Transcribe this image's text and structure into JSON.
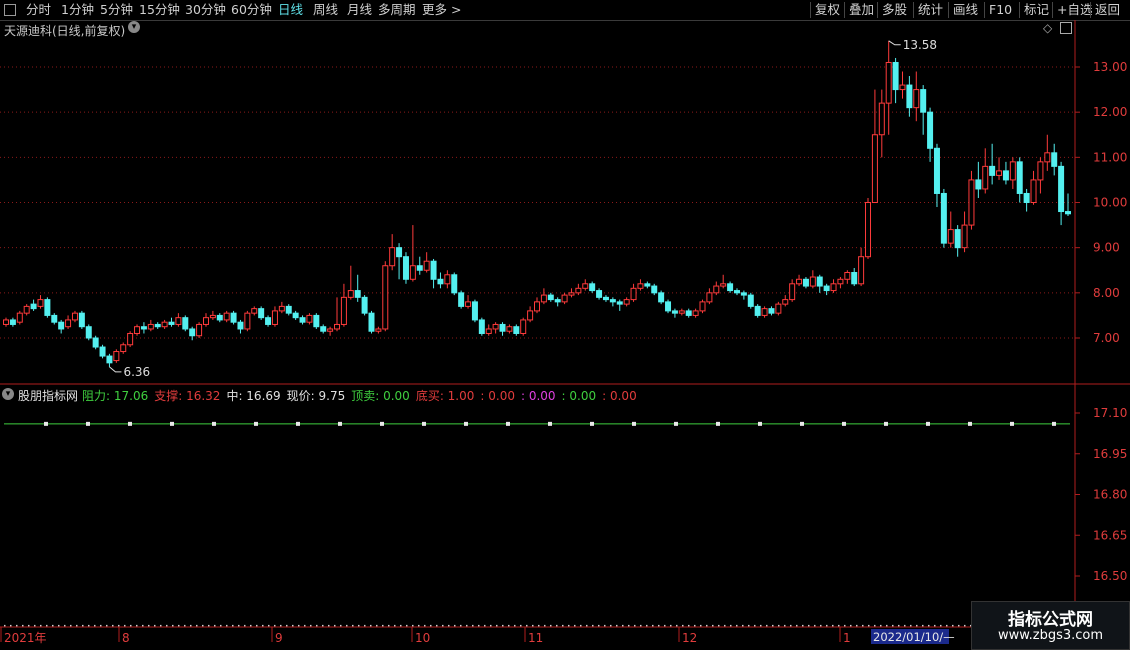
{
  "toolbar": {
    "left": [
      "分时",
      "1分钟",
      "5分钟",
      "15分钟",
      "30分钟",
      "60分钟",
      "日线",
      "周线",
      "月线",
      "多周期",
      "更多 >"
    ],
    "active": "日线",
    "right": [
      "复权",
      "叠加",
      "多股",
      "统计",
      "画线",
      "F10",
      "标记",
      "+自选",
      "返回"
    ]
  },
  "main_panel": {
    "title": "天源迪科(日线,前复权)",
    "price_axis": [
      "13.00",
      "12.00",
      "11.00",
      "10.00",
      "9.00",
      "8.00",
      "7.00"
    ],
    "high_label": "13.58",
    "low_label": "6.36"
  },
  "indicator_panel": {
    "source": "股朋指标网",
    "items": [
      {
        "label": "阻力:",
        "value": "17.06",
        "color": "#3fcf3f"
      },
      {
        "label": "支撑:",
        "value": "16.32",
        "color": "#e03c3c"
      },
      {
        "label": "中:",
        "value": "16.69",
        "color": "#e0e0e0"
      },
      {
        "label": "现价:",
        "value": "9.75",
        "color": "#e0e0e0"
      },
      {
        "label": "顶卖:",
        "value": "0.00",
        "color": "#3fcf3f"
      },
      {
        "label": "底买:",
        "value": "1.00",
        "color": "#e03c3c"
      },
      {
        "label": ":",
        "value": "0.00",
        "color": "#e03c3c"
      },
      {
        "label": ":",
        "value": "0.00",
        "color": "#e040e0"
      },
      {
        "label": ":",
        "value": "0.00",
        "color": "#3fcf3f"
      },
      {
        "label": ":",
        "value": "0.00",
        "color": "#e03c3c"
      }
    ],
    "axis": [
      "17.10",
      "16.95",
      "16.80",
      "16.65",
      "16.50"
    ]
  },
  "time_axis": {
    "labels": [
      "2021年",
      "8",
      "9",
      "10",
      "11",
      "12",
      "1"
    ],
    "cursor_date": "2022/01/10/—"
  },
  "logo": {
    "line1": "指标公式网",
    "line2": "www.zbgs3.com"
  },
  "colors": {
    "up": "#ff3b3b",
    "down": "#54f0f0",
    "grid": "#8b1a1a",
    "frame": "#b01e1e",
    "resistance": "#3fcf3f",
    "support_dots": "#d0d0d0"
  },
  "chart_data": {
    "type": "candlestick",
    "price_range": [
      6.3,
      14.0
    ],
    "indicator": {
      "resistance": 17.06,
      "support": 16.32,
      "range": [
        16.42,
        17.16
      ]
    },
    "candles": [
      [
        7.3,
        7.4,
        7.45,
        7.25
      ],
      [
        7.4,
        7.3,
        7.45,
        7.25
      ],
      [
        7.35,
        7.55,
        7.6,
        7.3
      ],
      [
        7.55,
        7.7,
        7.75,
        7.5
      ],
      [
        7.75,
        7.65,
        7.85,
        7.6
      ],
      [
        7.7,
        7.85,
        7.95,
        7.65
      ],
      [
        7.85,
        7.5,
        7.9,
        7.45
      ],
      [
        7.5,
        7.35,
        7.55,
        7.3
      ],
      [
        7.35,
        7.2,
        7.4,
        7.1
      ],
      [
        7.25,
        7.4,
        7.5,
        7.2
      ],
      [
        7.4,
        7.55,
        7.6,
        7.35
      ],
      [
        7.55,
        7.25,
        7.6,
        7.2
      ],
      [
        7.25,
        7.0,
        7.3,
        6.95
      ],
      [
        7.0,
        6.8,
        7.05,
        6.75
      ],
      [
        6.8,
        6.6,
        6.85,
        6.55
      ],
      [
        6.6,
        6.45,
        6.65,
        6.36
      ],
      [
        6.5,
        6.7,
        6.75,
        6.45
      ],
      [
        6.7,
        6.85,
        6.9,
        6.65
      ],
      [
        6.85,
        7.1,
        7.15,
        6.8
      ],
      [
        7.1,
        7.25,
        7.3,
        7.05
      ],
      [
        7.25,
        7.2,
        7.35,
        7.1
      ],
      [
        7.2,
        7.3,
        7.4,
        7.15
      ],
      [
        7.3,
        7.25,
        7.35,
        7.2
      ],
      [
        7.25,
        7.35,
        7.4,
        7.2
      ],
      [
        7.35,
        7.3,
        7.45,
        7.25
      ],
      [
        7.3,
        7.45,
        7.55,
        7.25
      ],
      [
        7.45,
        7.2,
        7.5,
        7.15
      ],
      [
        7.2,
        7.05,
        7.25,
        6.95
      ],
      [
        7.05,
        7.3,
        7.35,
        7.0
      ],
      [
        7.3,
        7.45,
        7.55,
        7.25
      ],
      [
        7.45,
        7.5,
        7.6,
        7.4
      ],
      [
        7.5,
        7.4,
        7.55,
        7.35
      ],
      [
        7.4,
        7.55,
        7.6,
        7.35
      ],
      [
        7.55,
        7.35,
        7.6,
        7.3
      ],
      [
        7.35,
        7.2,
        7.4,
        7.1
      ],
      [
        7.2,
        7.55,
        7.6,
        7.15
      ],
      [
        7.55,
        7.65,
        7.7,
        7.5
      ],
      [
        7.65,
        7.45,
        7.7,
        7.4
      ],
      [
        7.45,
        7.3,
        7.5,
        7.25
      ],
      [
        7.3,
        7.6,
        7.7,
        7.25
      ],
      [
        7.6,
        7.7,
        7.8,
        7.55
      ],
      [
        7.7,
        7.55,
        7.75,
        7.5
      ],
      [
        7.55,
        7.45,
        7.6,
        7.4
      ],
      [
        7.45,
        7.35,
        7.5,
        7.3
      ],
      [
        7.35,
        7.5,
        7.55,
        7.3
      ],
      [
        7.5,
        7.25,
        7.55,
        7.2
      ],
      [
        7.25,
        7.15,
        7.3,
        7.1
      ],
      [
        7.15,
        7.2,
        7.25,
        7.05
      ],
      [
        7.2,
        7.3,
        7.9,
        7.15
      ],
      [
        7.3,
        7.9,
        8.2,
        7.25
      ],
      [
        7.9,
        8.05,
        8.6,
        7.85
      ],
      [
        8.05,
        7.9,
        8.4,
        7.8
      ],
      [
        7.9,
        7.55,
        7.95,
        7.5
      ],
      [
        7.55,
        7.15,
        7.6,
        7.1
      ],
      [
        7.15,
        7.2,
        7.25,
        7.1
      ],
      [
        7.2,
        8.6,
        8.7,
        7.15
      ],
      [
        8.6,
        9.0,
        9.3,
        8.5
      ],
      [
        9.0,
        8.8,
        9.1,
        8.3
      ],
      [
        8.8,
        8.3,
        8.9,
        8.2
      ],
      [
        8.3,
        8.6,
        9.5,
        8.25
      ],
      [
        8.6,
        8.5,
        8.8,
        8.4
      ],
      [
        8.5,
        8.7,
        8.9,
        8.45
      ],
      [
        8.7,
        8.3,
        8.75,
        8.1
      ],
      [
        8.3,
        8.2,
        8.45,
        8.1
      ],
      [
        8.2,
        8.4,
        8.5,
        8.1
      ],
      [
        8.4,
        8.0,
        8.45,
        7.95
      ],
      [
        8.0,
        7.7,
        8.05,
        7.65
      ],
      [
        7.7,
        7.8,
        7.95,
        7.65
      ],
      [
        7.8,
        7.4,
        7.85,
        7.35
      ],
      [
        7.4,
        7.1,
        7.45,
        7.05
      ],
      [
        7.1,
        7.2,
        7.3,
        7.05
      ],
      [
        7.2,
        7.3,
        7.35,
        7.1
      ],
      [
        7.3,
        7.15,
        7.35,
        7.05
      ],
      [
        7.15,
        7.25,
        7.3,
        7.1
      ],
      [
        7.25,
        7.1,
        7.3,
        7.05
      ],
      [
        7.1,
        7.4,
        7.45,
        7.05
      ],
      [
        7.4,
        7.6,
        7.7,
        7.35
      ],
      [
        7.6,
        7.8,
        7.9,
        7.55
      ],
      [
        7.8,
        7.95,
        8.1,
        7.75
      ],
      [
        7.95,
        7.85,
        8.0,
        7.8
      ],
      [
        7.85,
        7.8,
        7.9,
        7.7
      ],
      [
        7.8,
        7.95,
        8.0,
        7.75
      ],
      [
        7.95,
        8.0,
        8.1,
        7.9
      ],
      [
        8.0,
        8.1,
        8.2,
        7.95
      ],
      [
        8.1,
        8.2,
        8.3,
        8.05
      ],
      [
        8.2,
        8.05,
        8.25,
        8.0
      ],
      [
        8.05,
        7.9,
        8.1,
        7.85
      ],
      [
        7.9,
        7.85,
        7.95,
        7.8
      ],
      [
        7.85,
        7.8,
        7.9,
        7.7
      ],
      [
        7.8,
        7.75,
        7.85,
        7.6
      ],
      [
        7.75,
        7.85,
        7.9,
        7.7
      ],
      [
        7.85,
        8.1,
        8.2,
        7.8
      ],
      [
        8.1,
        8.2,
        8.3,
        8.05
      ],
      [
        8.2,
        8.15,
        8.25,
        8.1
      ],
      [
        8.15,
        8.0,
        8.2,
        7.95
      ],
      [
        8.0,
        7.8,
        8.05,
        7.75
      ],
      [
        7.8,
        7.6,
        7.85,
        7.55
      ],
      [
        7.6,
        7.55,
        7.65,
        7.45
      ],
      [
        7.55,
        7.6,
        7.65,
        7.5
      ],
      [
        7.6,
        7.5,
        7.65,
        7.45
      ],
      [
        7.5,
        7.6,
        7.65,
        7.45
      ],
      [
        7.6,
        7.8,
        7.85,
        7.55
      ],
      [
        7.8,
        8.0,
        8.1,
        7.75
      ],
      [
        8.0,
        8.15,
        8.25,
        7.95
      ],
      [
        8.15,
        8.2,
        8.4,
        8.1
      ],
      [
        8.2,
        8.05,
        8.25,
        8.0
      ],
      [
        8.05,
        8.0,
        8.1,
        7.95
      ],
      [
        8.0,
        7.95,
        8.05,
        7.85
      ],
      [
        7.95,
        7.7,
        8.0,
        7.65
      ],
      [
        7.7,
        7.5,
        7.75,
        7.45
      ],
      [
        7.5,
        7.65,
        7.7,
        7.45
      ],
      [
        7.65,
        7.55,
        7.7,
        7.5
      ],
      [
        7.55,
        7.75,
        7.8,
        7.5
      ],
      [
        7.75,
        7.85,
        7.95,
        7.7
      ],
      [
        7.85,
        8.2,
        8.3,
        7.8
      ],
      [
        8.2,
        8.3,
        8.4,
        8.15
      ],
      [
        8.3,
        8.15,
        8.35,
        8.1
      ],
      [
        8.15,
        8.35,
        8.5,
        8.1
      ],
      [
        8.35,
        8.15,
        8.4,
        8.0
      ],
      [
        8.15,
        8.05,
        8.2,
        7.95
      ],
      [
        8.05,
        8.2,
        8.3,
        8.0
      ],
      [
        8.2,
        8.3,
        8.35,
        8.1
      ],
      [
        8.3,
        8.45,
        8.5,
        8.2
      ],
      [
        8.45,
        8.2,
        8.55,
        8.15
      ],
      [
        8.2,
        8.8,
        9.0,
        8.15
      ],
      [
        8.8,
        10.0,
        10.1,
        8.75
      ],
      [
        10.0,
        11.5,
        12.5,
        10.0
      ],
      [
        11.5,
        12.2,
        12.5,
        11.0
      ],
      [
        12.2,
        13.1,
        13.58,
        11.5
      ],
      [
        13.1,
        12.5,
        13.2,
        12.2
      ],
      [
        12.5,
        12.6,
        12.9,
        12.3
      ],
      [
        12.6,
        12.1,
        12.8,
        11.9
      ],
      [
        12.1,
        12.5,
        12.9,
        11.8
      ],
      [
        12.5,
        12.0,
        12.6,
        11.5
      ],
      [
        12.0,
        11.2,
        12.1,
        10.9
      ],
      [
        11.2,
        10.2,
        11.3,
        9.9
      ],
      [
        10.2,
        9.1,
        10.3,
        9.0
      ],
      [
        9.1,
        9.4,
        9.8,
        9.0
      ],
      [
        9.4,
        9.0,
        9.5,
        8.8
      ],
      [
        9.0,
        9.5,
        9.8,
        8.9
      ],
      [
        9.5,
        10.5,
        10.7,
        9.4
      ],
      [
        10.5,
        10.3,
        10.9,
        10.1
      ],
      [
        10.3,
        10.8,
        11.2,
        10.2
      ],
      [
        10.8,
        10.6,
        11.3,
        10.4
      ],
      [
        10.6,
        10.7,
        11.0,
        10.5
      ],
      [
        10.7,
        10.5,
        10.9,
        10.4
      ],
      [
        10.5,
        10.9,
        11.0,
        10.3
      ],
      [
        10.9,
        10.2,
        11.0,
        10.0
      ],
      [
        10.2,
        10.0,
        10.3,
        9.8
      ],
      [
        10.0,
        10.5,
        10.7,
        9.95
      ],
      [
        10.5,
        10.9,
        11.0,
        10.2
      ],
      [
        10.9,
        11.1,
        11.5,
        10.7
      ],
      [
        11.1,
        10.8,
        11.3,
        10.6
      ],
      [
        10.8,
        9.8,
        10.9,
        9.5
      ],
      [
        9.8,
        9.75,
        10.2,
        9.7
      ]
    ]
  }
}
